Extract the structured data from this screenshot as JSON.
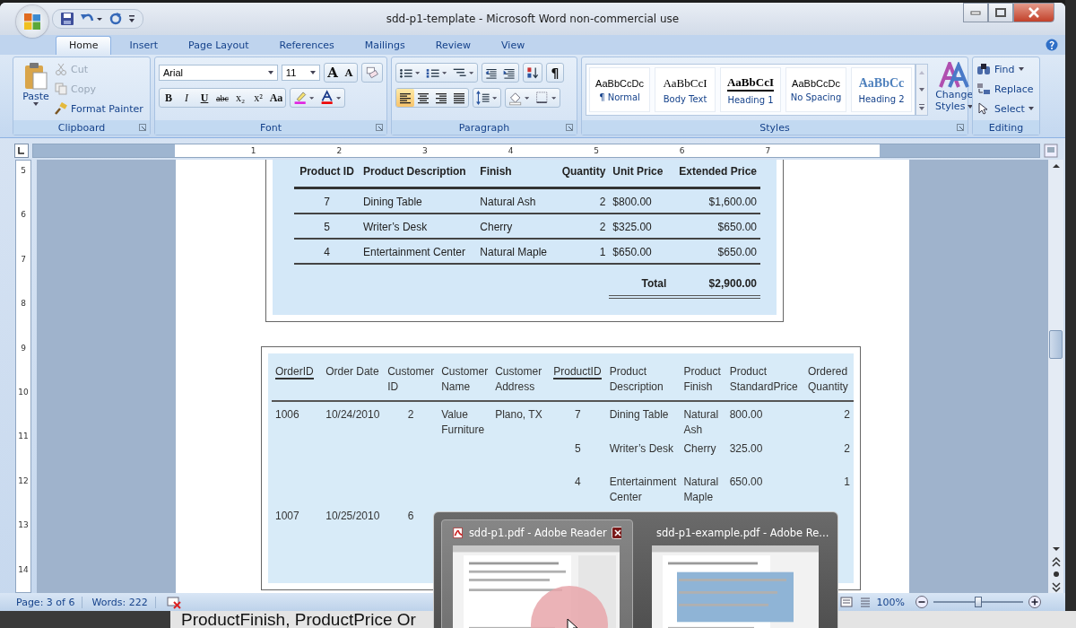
{
  "window": {
    "title": "sdd-p1-template - Microsoft Word non-commercial use"
  },
  "tabs": [
    {
      "label": "Home",
      "selected": true
    },
    {
      "label": "Insert",
      "selected": false
    },
    {
      "label": "Page Layout",
      "selected": false
    },
    {
      "label": "References",
      "selected": false
    },
    {
      "label": "Mailings",
      "selected": false
    },
    {
      "label": "Review",
      "selected": false
    },
    {
      "label": "View",
      "selected": false
    }
  ],
  "clipboard": {
    "paste": "Paste",
    "cut": "Cut",
    "copy": "Copy",
    "format_painter": "Format Painter",
    "label": "Clipboard"
  },
  "font": {
    "name": "Arial",
    "size": "11",
    "grow": "A",
    "shrink": "A",
    "formats": [
      "B",
      "I",
      "U",
      "abc",
      "x₂",
      "x²",
      "Aa"
    ],
    "label": "Font"
  },
  "paragraph": {
    "label": "Paragraph",
    "pilcrow": "¶",
    "alignments": [
      {
        "kind": "left",
        "selected": true
      },
      {
        "kind": "center",
        "selected": false
      },
      {
        "kind": "right",
        "selected": false
      },
      {
        "kind": "justify",
        "selected": false
      }
    ]
  },
  "styles": {
    "label": "Styles",
    "items": [
      {
        "kind": "normal",
        "preview": "AaBbCcDc",
        "name": "¶ Normal"
      },
      {
        "kind": "body",
        "preview": "AaBbCcI",
        "name": "Body Text"
      },
      {
        "kind": "heading1",
        "preview": "AaBbCcI",
        "name": "Heading 1"
      },
      {
        "kind": "nospacing",
        "preview": "AaBbCcDc",
        "name": "No Spacing"
      },
      {
        "kind": "heading2",
        "preview": "AaBbCc",
        "name": "Heading 2"
      }
    ],
    "change": [
      "Change",
      "Styles"
    ]
  },
  "editing": {
    "label": "Editing",
    "find": "Find",
    "replace": "Replace",
    "select": "Select"
  },
  "ruler": {
    "horizontal": [
      "1",
      "2",
      "3",
      "4",
      "5",
      "6",
      "7"
    ],
    "vertical": [
      "5",
      "6",
      "7",
      "8",
      "9",
      "10",
      "11",
      "12",
      "13",
      "14"
    ]
  },
  "invoice": {
    "columns": [
      "Product ID",
      "Product Description",
      "Finish",
      "Quantity",
      "Unit Price",
      "Extended Price"
    ],
    "rows": [
      [
        "7",
        "Dining Table",
        "Natural Ash",
        "2",
        "$800.00",
        "$1,600.00"
      ],
      [
        "5",
        "Writer’s Desk",
        "Cherry",
        "2",
        "$325.00",
        "$650.00"
      ],
      [
        "4",
        "Entertainment Center",
        "Natural Maple",
        "1",
        "$650.00",
        "$650.00"
      ]
    ],
    "total_label": "Total",
    "total_value": "$2,900.00"
  },
  "orders": {
    "columns": [
      {
        "label": "OrderID",
        "key": true
      },
      {
        "label": "Order Date",
        "key": false
      },
      {
        "label": "Customer ID",
        "key": false
      },
      {
        "label": "Customer Name",
        "key": false
      },
      {
        "label": "Customer Address",
        "key": false
      },
      {
        "label": "ProductID",
        "key": true
      },
      {
        "label": "Product Description",
        "key": false
      },
      {
        "label": "Product Finish",
        "key": false
      },
      {
        "label": "Product StandardPrice",
        "key": false
      },
      {
        "label": "Ordered Quantity",
        "key": false
      }
    ],
    "rows": [
      {
        "order_id": "1006",
        "date": "10/24/2010",
        "customer_id": "2",
        "customer_name": "Value Furniture",
        "customer_address": "Plano, TX",
        "products": [
          {
            "product_id": "7",
            "description": "Dining Table",
            "finish": "Natural Ash",
            "price": "800.00",
            "quantity": "2"
          },
          {
            "product_id": "5",
            "description": "Writer’s Desk",
            "finish": "Cherry",
            "price": "325.00",
            "quantity": "2"
          },
          {
            "product_id": "4",
            "description": "Entertainment Center",
            "finish": "Natural Maple",
            "price": "650.00",
            "quantity": "1"
          }
        ]
      },
      {
        "order_id": "1007",
        "date": "10/25/2010",
        "customer_id": "6"
      }
    ]
  },
  "status_bar": {
    "page": "Page: 3 of 6",
    "words": "Words: 222",
    "zoom": "100%",
    "zoom_slider": {
      "level": 0.5
    }
  },
  "taskbar_preview": [
    {
      "title": "sdd-p1.pdf - Adobe Reader",
      "selected": true
    },
    {
      "title": "sdd-p1-example.pdf - Adobe Re...",
      "selected": false
    }
  ],
  "background_text": "ProductFinish, ProductPrice Or"
}
